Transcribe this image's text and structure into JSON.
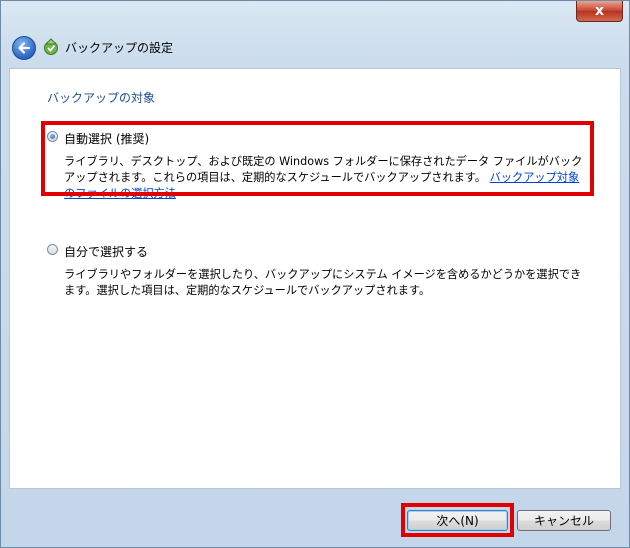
{
  "window": {
    "close_glyph": "x",
    "title": "バックアップの設定"
  },
  "section": {
    "title": "バックアップの対象"
  },
  "options": [
    {
      "label": "自動選択 (推奨)",
      "selected": true,
      "description": "ライブラリ、デスクトップ、および既定の Windows フォルダーに保存されたデータ ファイルがバックアップされます。これらの項目は、定期的なスケジュールでバックアップされます。",
      "link": "バックアップ対象のファイルの選択方法"
    },
    {
      "label": "自分で選択する",
      "selected": false,
      "description": "ライブラリやフォルダーを選択したり、バックアップにシステム イメージを含めるかどうかを選択できます。選択した項目は、定期的なスケジュールでバックアップされます。"
    }
  ],
  "buttons": {
    "next": "次へ(N)",
    "cancel": "キャンセル"
  },
  "colors": {
    "highlight": "#e00000",
    "section_title": "#1f4f8f",
    "link": "#0044cc"
  }
}
